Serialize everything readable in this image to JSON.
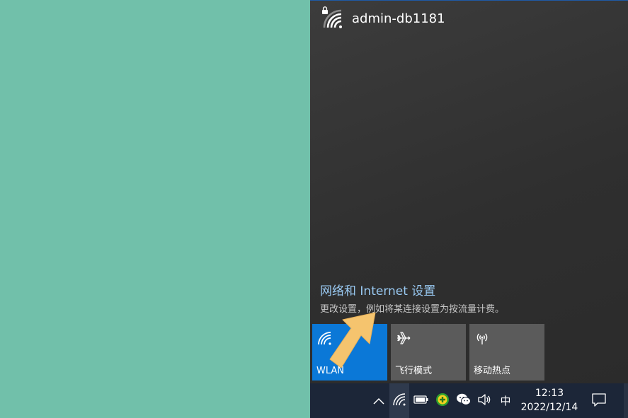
{
  "network": {
    "name": "admin-db1181",
    "icon": "wifi-secured-icon"
  },
  "settings": {
    "link": "网络和 Internet 设置",
    "description": "更改设置，例如将某连接设置为按流量计费。"
  },
  "quick_actions": [
    {
      "label": "WLAN",
      "icon": "wifi-icon",
      "active": true
    },
    {
      "label": "飞行模式",
      "icon": "airplane-icon",
      "active": false
    },
    {
      "label": "移动热点",
      "icon": "hotspot-icon",
      "active": false
    }
  ],
  "taskbar": {
    "ime": "中",
    "time": "12:13",
    "date": "2022/12/14"
  },
  "colors": {
    "desktop": "#71c0aa",
    "panel": "#333333",
    "accent": "#0b78d7",
    "link": "#99c9f2",
    "taskbar": "#1c2638",
    "arrow": "#f5c46e"
  }
}
